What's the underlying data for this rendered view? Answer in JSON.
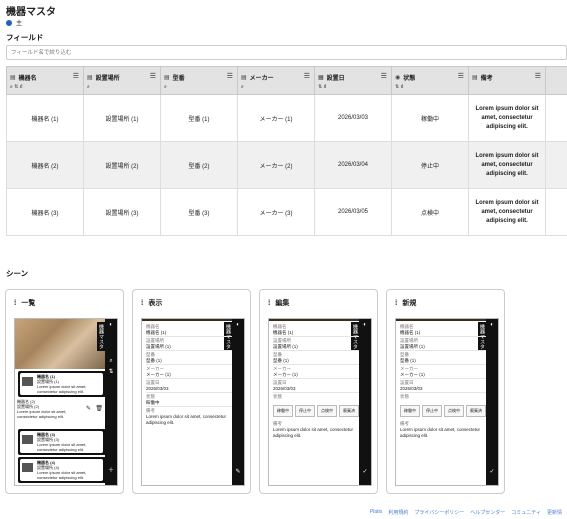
{
  "title": "機器マスタ",
  "primary_label": "主",
  "fields_heading": "フィールド",
  "filter_placeholder": "フィールド名で絞り込む",
  "columns": [
    "機器名",
    "設置場所",
    "型番",
    "メーカー",
    "設置日",
    "状態",
    "備考"
  ],
  "rows": [
    {
      "name": "機器名 (1)",
      "place": "設置場所 (1)",
      "model": "型番 (1)",
      "maker": "メーカー (1)",
      "date": "2026/03/03",
      "status": "稼働中",
      "note": "Lorem ipsum dolor sit amet, consectetur adipiscing elit."
    },
    {
      "name": "機器名 (2)",
      "place": "設置場所 (2)",
      "model": "型番 (2)",
      "maker": "メーカー (2)",
      "date": "2026/03/04",
      "status": "停止中",
      "note": "Lorem ipsum dolor sit amet, consectetur adipiscing elit."
    },
    {
      "name": "機器名 (3)",
      "place": "設置場所 (3)",
      "model": "型番 (3)",
      "maker": "メーカー (3)",
      "date": "2026/03/05",
      "status": "点検中",
      "note": "Lorem ipsum dolor sit amet, consectetur adipiscing elit."
    }
  ],
  "scenes_heading": "シーン",
  "scenes": [
    {
      "label": "一覧"
    },
    {
      "label": "表示"
    },
    {
      "label": "編集"
    },
    {
      "label": "新規"
    }
  ],
  "phone_title": "機器マスタ",
  "list_items": [
    {
      "l1": "機器名 (1)",
      "l2": "設置場所 (1)",
      "l3": "Lorem ipsum dolor sit amet,",
      "l4": "consectetur adipiscing elit."
    },
    {
      "l1": "機器名 (2)",
      "l2": "設置場所 (2)",
      "l3": "Lorem ipsum dolor sit amet,",
      "l4": "consectetur adipiscing elit."
    },
    {
      "l1": "機器名 (3)",
      "l2": "設置場所 (3)",
      "l3": "Lorem ipsum dolor sit amet,",
      "l4": "consectetur adipiscing elit."
    },
    {
      "l1": "機器名 (4)",
      "l2": "設置場所 (4)",
      "l3": "Lorem ipsum dolor sit amet,",
      "l4": "consectetur adipiscing elit."
    }
  ],
  "detail": {
    "f1_label": "機器名",
    "f1": "機器名 (1)",
    "f2_label": "設置場所",
    "f2": "設置場所 (1)",
    "f3_label": "型番",
    "f3": "型番 (1)",
    "f4_label": "メーカー",
    "f4": "メーカー (1)",
    "f5_label": "設置日",
    "f5": "2026/03/03",
    "f6_label": "状態",
    "f6": "稼働中",
    "f7_label": "備考",
    "f7": "Lorem ipsum dolor sit amet, consectetur adipiscing elit."
  },
  "status_chips": [
    "稼働中",
    "停止中",
    "点検中",
    "廃棄済"
  ],
  "footer_links": [
    "Platio",
    "利用規約",
    "プライバシーポリシー",
    "ヘルプセンター",
    "コミュニティ",
    "更新情"
  ]
}
